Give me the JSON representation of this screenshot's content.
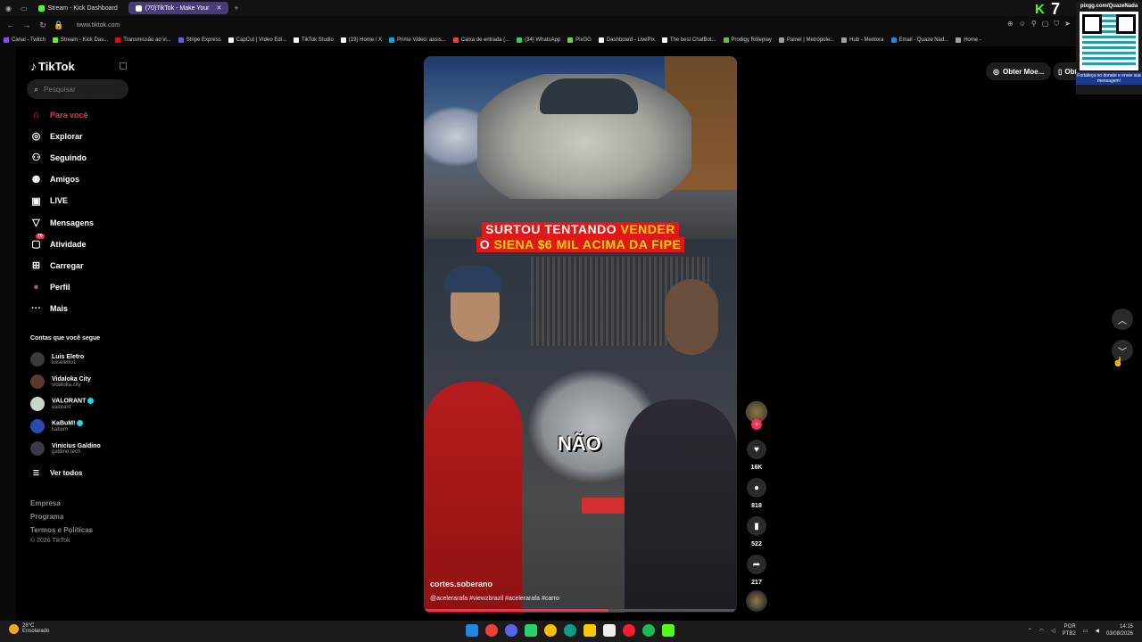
{
  "browser": {
    "tabs": [
      {
        "label": "Stream - Kick Dashboard",
        "active": false,
        "color": "#53fc18"
      },
      {
        "label": "(70)TikTok - Make Your",
        "active": true,
        "color": "#ffffff"
      }
    ],
    "url": "www.tiktok.com",
    "bookmarks": [
      {
        "label": "Canal - Twitch",
        "color": "#9146ff"
      },
      {
        "label": "Stream - Kick Das...",
        "color": "#53fc18"
      },
      {
        "label": "Transmissão ao vi...",
        "color": "#ff0000"
      },
      {
        "label": "Stripe Express",
        "color": "#635bff"
      },
      {
        "label": "CapCut | Vídeo Edi...",
        "color": "#ffffff"
      },
      {
        "label": "TikTok Studio",
        "color": "#ffffff"
      },
      {
        "label": "(19) Home / X",
        "color": "#ffffff"
      },
      {
        "label": "Prime Video: assis...",
        "color": "#00a8e1"
      },
      {
        "label": "Caixa de entrada (...",
        "color": "#ea4335"
      },
      {
        "label": "(34) WhatsApp",
        "color": "#25d366"
      },
      {
        "label": "PixGG",
        "color": "#8bc34a"
      },
      {
        "label": "Dashboard - LivePix",
        "color": "#ffffff"
      },
      {
        "label": "The best ChatBot...",
        "color": "#ffffff"
      },
      {
        "label": "Prodigy Roleplay",
        "color": "#7cb342"
      },
      {
        "label": "Painel | Metrópole...",
        "color": "#9e9e9e"
      },
      {
        "label": "Hub - Mentora",
        "color": "#9e9e9e"
      },
      {
        "label": "Email - Quaze Nad...",
        "color": "#1e88e5"
      },
      {
        "label": "Home -",
        "color": "#9e9e9e"
      }
    ]
  },
  "sidebar": {
    "logo": "TikTok",
    "search_placeholder": "Pesquisar",
    "nav": [
      {
        "label": "Para você",
        "icon": "home-icon",
        "active": true
      },
      {
        "label": "Explorar",
        "icon": "compass-icon",
        "active": false
      },
      {
        "label": "Seguindo",
        "icon": "following-icon",
        "active": false
      },
      {
        "label": "Amigos",
        "icon": "friends-icon",
        "active": false
      },
      {
        "label": "LIVE",
        "icon": "live-icon",
        "active": false
      },
      {
        "label": "Mensagens",
        "icon": "messages-icon",
        "active": false
      },
      {
        "label": "Atividade",
        "icon": "activity-icon",
        "active": false,
        "badge": "70"
      },
      {
        "label": "Carregar",
        "icon": "upload-icon",
        "active": false
      },
      {
        "label": "Perfil",
        "icon": "profile-avatar",
        "active": false
      },
      {
        "label": "Mais",
        "icon": "more-icon",
        "active": false
      }
    ],
    "following_title": "Contas que você segue",
    "accounts": [
      {
        "name": "Luis Eletro",
        "handle": "luiseletro1",
        "verified": false,
        "color": "#3a3a3a"
      },
      {
        "name": "Vidaloka City",
        "handle": "vidaloka.city",
        "verified": false,
        "color": "#5a3a2a"
      },
      {
        "name": "VALORANT",
        "handle": "valorant",
        "verified": true,
        "color": "#c8d8c8"
      },
      {
        "name": "KaBuM!",
        "handle": "kabum",
        "verified": true,
        "color": "#2a4ab0"
      },
      {
        "name": "Vinicius Galdino",
        "handle": "galdino.tech",
        "verified": false,
        "color": "#3a3a4a"
      }
    ],
    "see_all": "Ver todos",
    "footer": [
      "Empresa",
      "Programa",
      "Termos e Políticas"
    ],
    "copyright": "© 2026 TikTok"
  },
  "video": {
    "headline_line1": [
      "SURTOU TENTANDO ",
      "VENDER"
    ],
    "headline_line2": [
      "O ",
      "SIENA $6 MIL ",
      "ACIMA DA FIPE"
    ],
    "subtitle": "NÃO",
    "author": "cortes.soberano",
    "caption": "@acelerarafa #viewzbrazil #acelerarafa #carro",
    "progress_percent": 59
  },
  "actions": {
    "likes": "16K",
    "comments": "818",
    "saves": "522",
    "shares": "217"
  },
  "header_buttons": {
    "coins": "Obter Moe...",
    "app": "Obt"
  },
  "overlay": {
    "kick_count": "7",
    "qr_url": "pixgg.com/QuazeNada",
    "qr_caption": "Fortaleça no donate e envie sua mensagem!"
  },
  "taskbar": {
    "weather_temp": "28°C",
    "weather_desc": "Ensolarado",
    "lang": "POR",
    "lang2": "PTB2",
    "time": "14:15",
    "date": "03/08/2026"
  }
}
